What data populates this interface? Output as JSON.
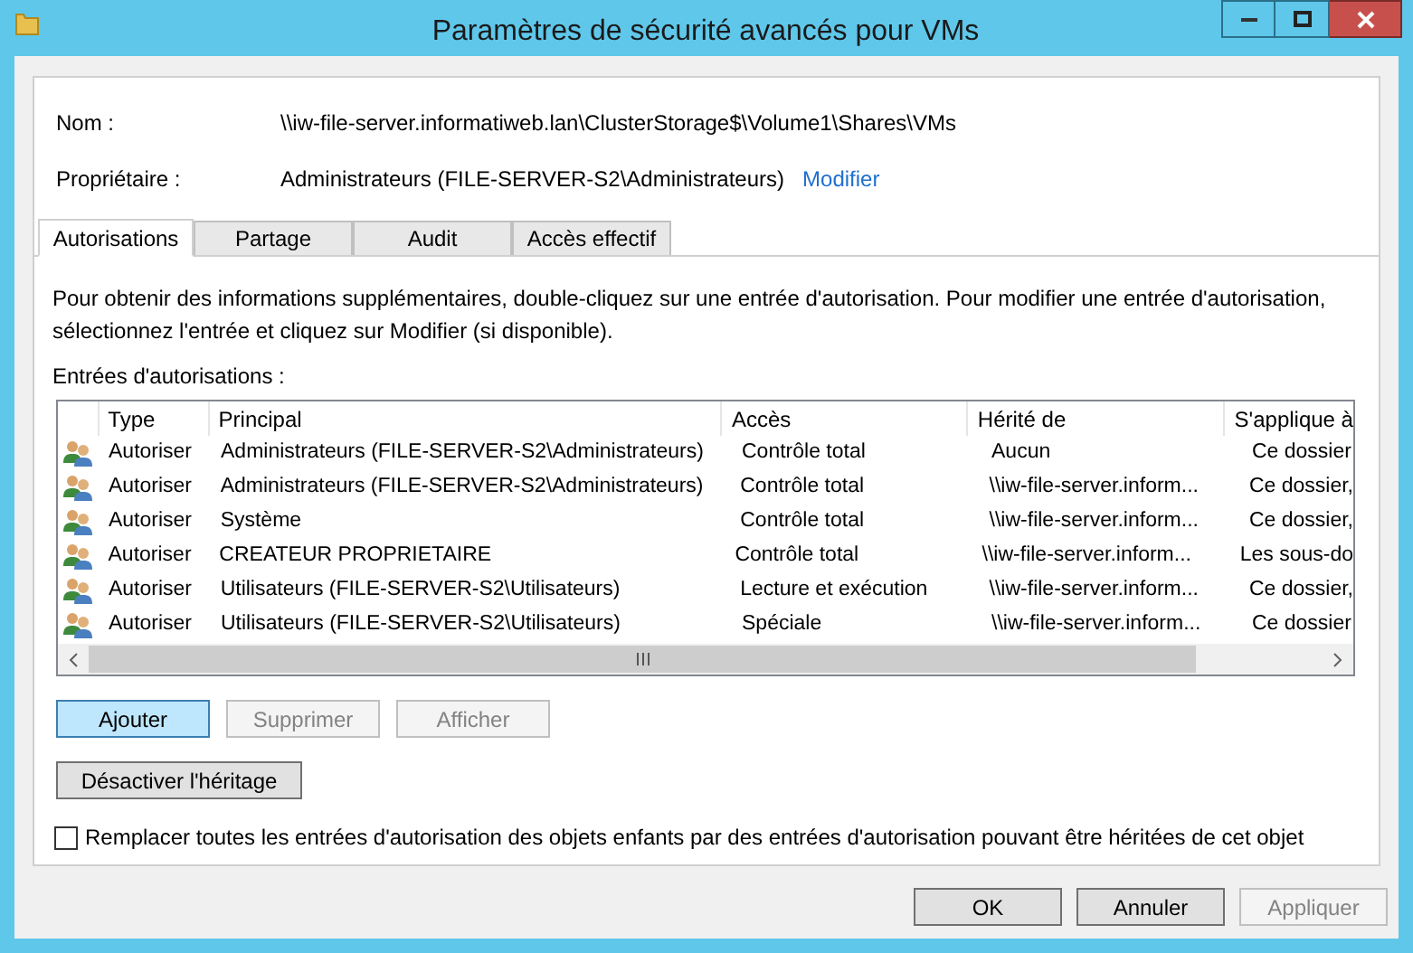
{
  "window": {
    "title": "Paramètres de sécurité avancés pour VMs"
  },
  "name_label": "Nom :",
  "name_value": "\\\\iw-file-server.informatiweb.lan\\ClusterStorage$\\Volume1\\Shares\\VMs",
  "owner_label": "Propriétaire :",
  "owner_value": "Administrateurs (FILE-SERVER-S2\\Administrateurs)",
  "owner_link": "Modifier",
  "tabs": [
    {
      "label": "Autorisations",
      "selected": true
    },
    {
      "label": "Partage",
      "selected": false
    },
    {
      "label": "Audit",
      "selected": false
    },
    {
      "label": "Accès effectif",
      "selected": false
    }
  ],
  "description": "Pour obtenir des informations supplémentaires, double-cliquez sur une entrée d'autorisation. Pour modifier une entrée d'autorisation, sélectionnez l'entrée et cliquez sur Modifier (si disponible).",
  "list_label": "Entrées d'autorisations :",
  "table": {
    "columns": [
      "Type",
      "Principal",
      "Accès",
      "Hérité de",
      "S'applique à"
    ],
    "rows": [
      [
        "Autoriser",
        "Administrateurs (FILE-SERVER-S2\\Administrateurs)",
        "Contrôle total",
        "Aucun",
        "Ce dossier"
      ],
      [
        "Autoriser",
        "Administrateurs (FILE-SERVER-S2\\Administrateurs)",
        "Contrôle total",
        "\\\\iw-file-server.inform...",
        "Ce dossier,"
      ],
      [
        "Autoriser",
        "Système",
        "Contrôle total",
        "\\\\iw-file-server.inform...",
        "Ce dossier,"
      ],
      [
        "Autoriser",
        "CREATEUR PROPRIETAIRE",
        "Contrôle total",
        "\\\\iw-file-server.inform...",
        "Les sous-do"
      ],
      [
        "Autoriser",
        "Utilisateurs (FILE-SERVER-S2\\Utilisateurs)",
        "Lecture et exécution",
        "\\\\iw-file-server.inform...",
        "Ce dossier,"
      ],
      [
        "Autoriser",
        "Utilisateurs (FILE-SERVER-S2\\Utilisateurs)",
        "Spéciale",
        "\\\\iw-file-server.inform...",
        "Ce dossier"
      ]
    ]
  },
  "list_buttons": [
    {
      "label": "Ajouter",
      "disabled": false,
      "focused": true
    },
    {
      "label": "Supprimer",
      "disabled": true,
      "focused": false
    },
    {
      "label": "Afficher",
      "disabled": true,
      "focused": false
    }
  ],
  "inheritance_button": "Désactiver l'héritage",
  "replace_checkbox": {
    "label": "Remplacer toutes les entrées d'autorisation des objets enfants par des entrées d'autorisation pouvant être héritées de cet objet",
    "checked": false
  },
  "dialog_buttons": [
    {
      "label": "OK",
      "disabled": false
    },
    {
      "label": "Annuler",
      "disabled": false
    },
    {
      "label": "Appliquer",
      "disabled": true
    }
  ]
}
